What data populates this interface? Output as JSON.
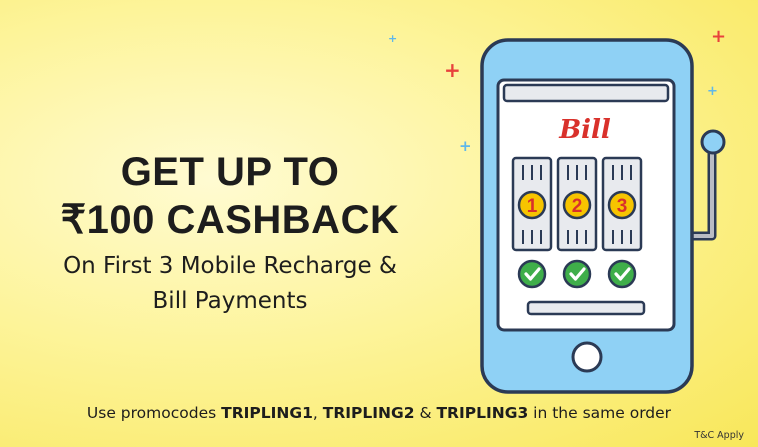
{
  "banner": {
    "headline_line1": "GET UP TO",
    "headline_line2": "₹100 CASHBACK",
    "subline_1": "On First 3 Mobile Recharge &",
    "subline_2": "Bill Payments",
    "promo_prefix": "Use promocodes ",
    "promo_code_1": "TRIPLING1",
    "promo_sep_1": ", ",
    "promo_code_2": "TRIPLING2",
    "promo_sep_2": " & ",
    "promo_code_3": "TRIPLING3",
    "promo_suffix": " in the same order",
    "terms": "T&C Apply"
  },
  "phone": {
    "screen_title": "Bill",
    "reel_numbers": [
      "1",
      "2",
      "3"
    ]
  },
  "colors": {
    "background": "#fdf49a",
    "phone_frame": "#8fd1f5",
    "outline": "#2b3a55",
    "check_green": "#3fae4a",
    "coin_yellow": "#f7c400",
    "bill_red": "#d9312b",
    "spark_red": "#e8413c",
    "spark_blue": "#5fb8ea"
  },
  "icons": [
    "bill-logo",
    "slot-reel",
    "coin-icon",
    "check-icon",
    "home-button-icon",
    "lever-icon",
    "sparkle-icon"
  ]
}
